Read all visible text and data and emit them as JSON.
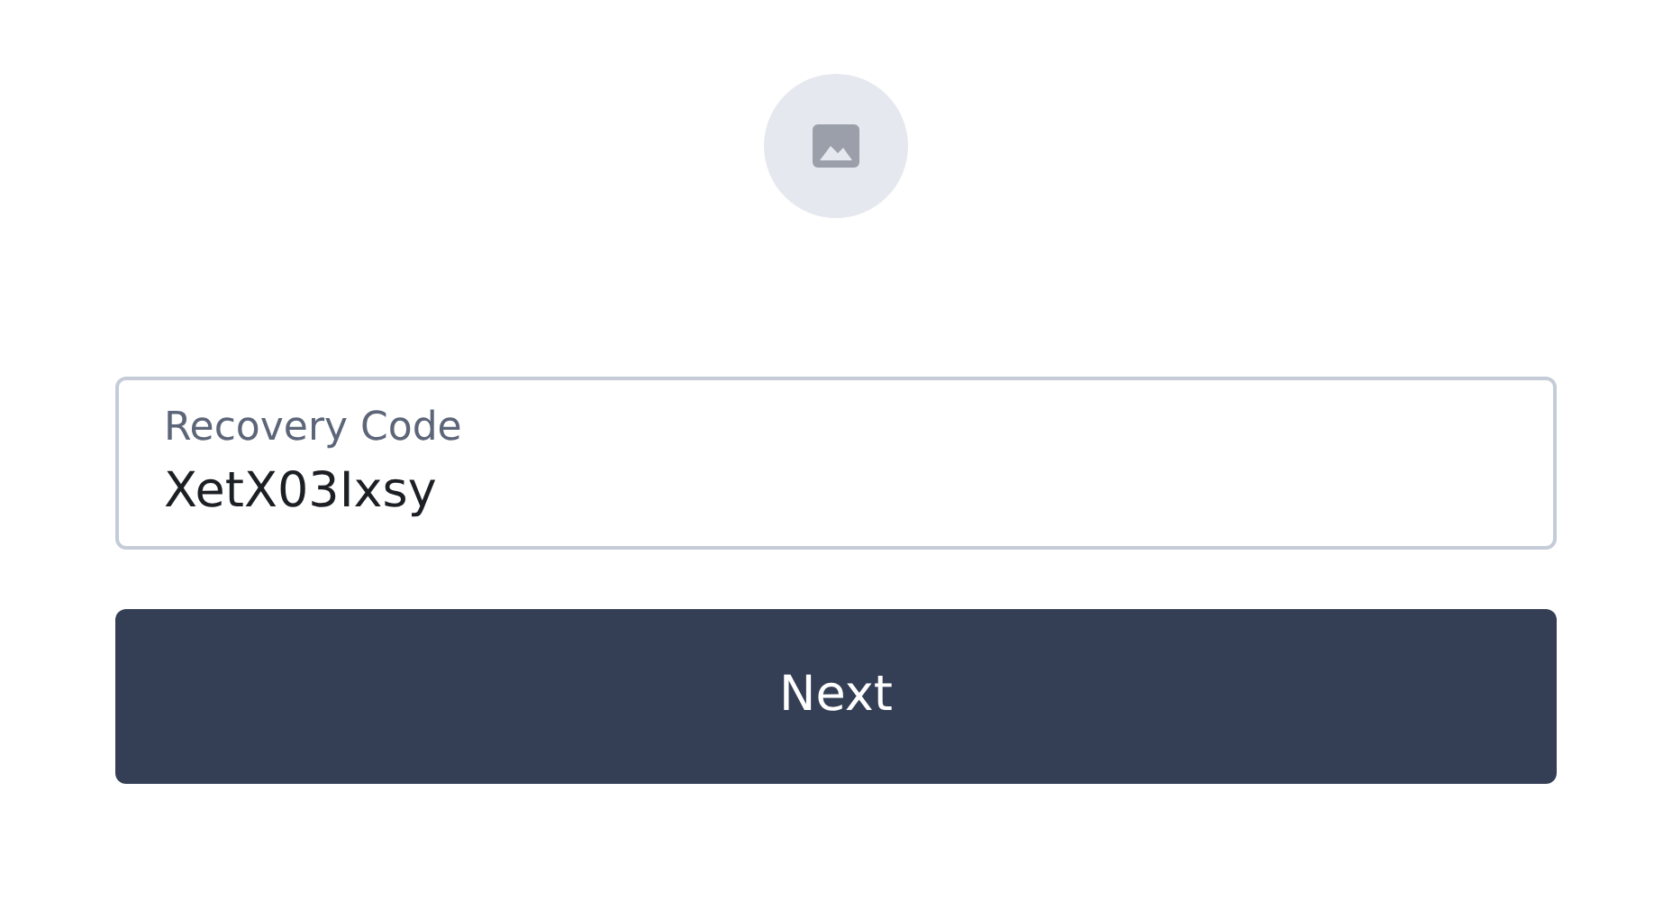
{
  "field": {
    "label": "Recovery Code",
    "value": "XetX03Ixsy"
  },
  "button": {
    "label": "Next"
  }
}
